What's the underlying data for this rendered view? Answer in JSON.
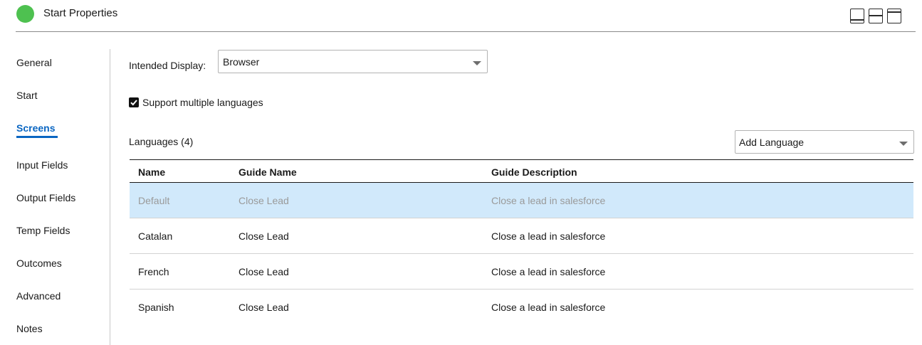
{
  "header": {
    "title": "Start Properties",
    "status_color": "#4ec150",
    "layout_buttons": [
      "layout-bottom-panel-icon",
      "layout-split-panel-icon",
      "layout-top-panel-icon"
    ]
  },
  "sidebar": {
    "items": [
      {
        "label": "General"
      },
      {
        "label": "Start"
      },
      {
        "label": "Screens",
        "active": true
      },
      {
        "label": "Input Fields"
      },
      {
        "label": "Output Fields"
      },
      {
        "label": "Temp Fields"
      },
      {
        "label": "Outcomes"
      },
      {
        "label": "Advanced"
      },
      {
        "label": "Notes"
      }
    ],
    "accent_color": "#0a66c2"
  },
  "main": {
    "intended_display_label": "Intended Display:",
    "intended_display_value": "Browser",
    "support_languages_label": "Support multiple languages",
    "support_languages_checked": true,
    "languages_heading": "Languages (4)",
    "add_language_value": "Add Language",
    "table": {
      "columns": [
        "Name",
        "Guide Name",
        "Guide Description"
      ],
      "rows": [
        {
          "name": "Default",
          "guide_name": "Close Lead",
          "guide_description": "Close a lead in salesforce",
          "selected": true
        },
        {
          "name": "Catalan",
          "guide_name": "Close Lead",
          "guide_description": "Close a lead in salesforce"
        },
        {
          "name": "French",
          "guide_name": "Close Lead",
          "guide_description": "Close a lead in salesforce"
        },
        {
          "name": "Spanish",
          "guide_name": "Close Lead",
          "guide_description": "Close a lead in salesforce"
        }
      ],
      "selected_row_color": "#d1e9fb"
    }
  }
}
